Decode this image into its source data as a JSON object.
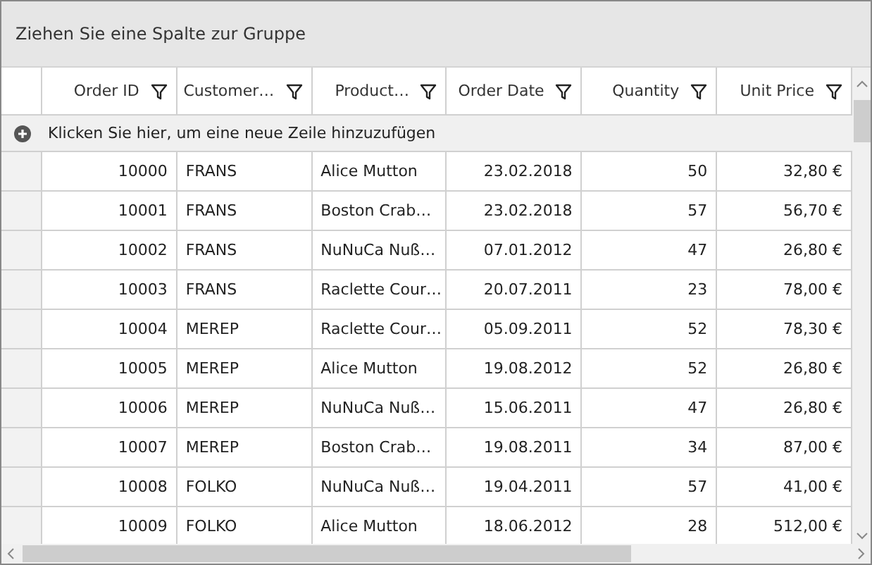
{
  "group_panel": {
    "text": "Ziehen Sie eine Spalte zur Gruppe"
  },
  "columns": [
    {
      "label": "Order ID"
    },
    {
      "label": "Customer…"
    },
    {
      "label": "Product…"
    },
    {
      "label": "Order Date"
    },
    {
      "label": "Quantity"
    },
    {
      "label": "Unit Price"
    }
  ],
  "new_row": {
    "text": "Klicken Sie hier, um eine neue Zeile hinzuzufügen"
  },
  "rows": [
    [
      "10000",
      "FRANS",
      "Alice Mutton",
      "23.02.2018",
      "50",
      "32,80 €"
    ],
    [
      "10001",
      "FRANS",
      "Boston  Crab…",
      "23.02.2018",
      "57",
      "56,70 €"
    ],
    [
      "10002",
      "FRANS",
      "NuNuCa  Nuß…",
      "07.01.2012",
      "47",
      "26,80 €"
    ],
    [
      "10003",
      "FRANS",
      "Raclette  Cour…",
      "20.07.2011",
      "23",
      "78,00 €"
    ],
    [
      "10004",
      "MEREP",
      "Raclette  Cour…",
      "05.09.2011",
      "52",
      "78,30 €"
    ],
    [
      "10005",
      "MEREP",
      "Alice Mutton",
      "19.08.2012",
      "52",
      "26,80 €"
    ],
    [
      "10006",
      "MEREP",
      "NuNuCa  Nuß…",
      "15.06.2011",
      "47",
      "26,80 €"
    ],
    [
      "10007",
      "MEREP",
      "Boston  Crab…",
      "19.08.2011",
      "34",
      "87,00 €"
    ],
    [
      "10008",
      "FOLKO",
      "NuNuCa  Nuß…",
      "19.04.2011",
      "57",
      "41,00 €"
    ],
    [
      "10009",
      "FOLKO",
      "Alice Mutton",
      "18.06.2012",
      "28",
      "512,00 €"
    ]
  ]
}
